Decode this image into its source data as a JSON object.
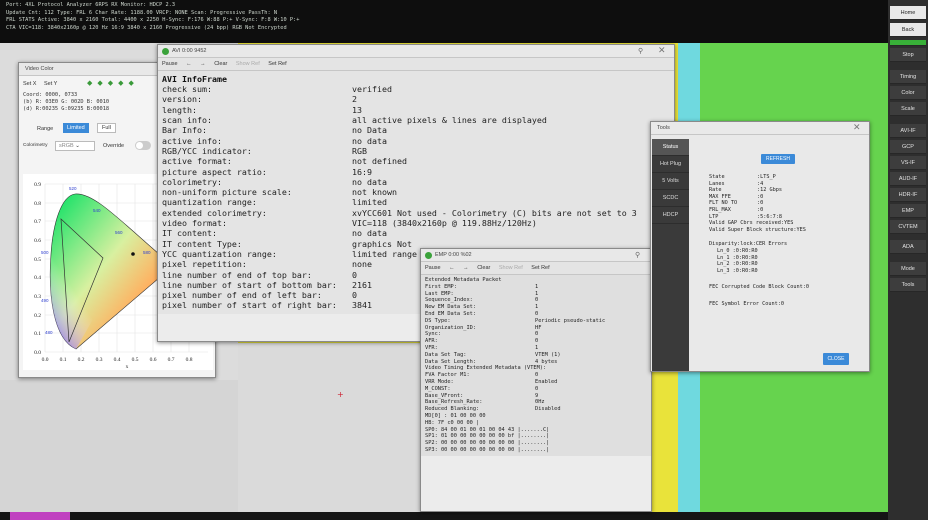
{
  "status_bar": {
    "lines": [
      "Port: 4XL Protocol Analyzer 6RPS RX   Monitor: HDCP 2.3",
      "Update Cnt: 112  Type: FRL 6  Char Rate: 1188.00  VRCP: NONE  Scan: Progressive  PassTh: N",
      "FRL STATS  Active: 3840 x 2160  Total: 4400 x 2250  H-Sync: F:176 W:88 P:+  V-Sync: F:8 W:10 P:+",
      "CTA VIC=118: 3840x2160p @ 120 Hz 16:9  3840 x 2160  Progressive  (24 bpp)  RGB  Not Encrypted"
    ]
  },
  "rail": {
    "buttons": [
      "Home",
      "Back",
      "Stop",
      "Timing",
      "Color",
      "Scale",
      "AVI-IF",
      "GCP",
      "VS-IF",
      "AUD-IF",
      "HDR-IF",
      "EMP",
      "CVTEM",
      "ADA",
      "Mode",
      "Tools"
    ]
  },
  "avi_window": {
    "title": "AVI 0:00 9452",
    "toolbar": {
      "pause": "Pause",
      "prev": "←",
      "next": "→",
      "clear": "Clear",
      "show_ref": "Show Ref",
      "set_ref": "Set Ref"
    },
    "header": "AVI InfoFrame",
    "fields": [
      {
        "k": "check sum:",
        "v": "verified"
      },
      {
        "k": "version:",
        "v": "2"
      },
      {
        "k": "length:",
        "v": "13"
      },
      {
        "k": "scan info:",
        "v": "all active pixels & lines are displayed"
      },
      {
        "k": "Bar Info:",
        "v": "no Data"
      },
      {
        "k": "active info:",
        "v": "no data"
      },
      {
        "k": "RGB/YCC indicator:",
        "v": "RGB"
      },
      {
        "k": "active format:",
        "v": "not defined"
      },
      {
        "k": "picture aspect ratio:",
        "v": "16:9"
      },
      {
        "k": "colorimetry:",
        "v": "no data"
      },
      {
        "k": "non-uniform picture scale:",
        "v": "not known"
      },
      {
        "k": "quantization range:",
        "v": "limited"
      },
      {
        "k": "extended colorimetry:",
        "v": "xvYCC601 Not used - Colorimetry (C) bits are not set to 3"
      },
      {
        "k": "video format:",
        "v": "VIC=118 (3840x2160p @ 119.88Hz/120Hz)"
      },
      {
        "k": "IT content:",
        "v": "no data"
      },
      {
        "k": "IT content Type:",
        "v": "graphics Not"
      },
      {
        "k": "YCC quantization range:",
        "v": "limited range"
      },
      {
        "k": "pixel repetition:",
        "v": "none"
      },
      {
        "k": "line number of end of top bar:",
        "v": "0"
      },
      {
        "k": "line number of start of bottom bar:",
        "v": "2161"
      },
      {
        "k": "pixel number of end of left bar:",
        "v": "0"
      },
      {
        "k": "pixel number of start of right bar:",
        "v": "3841"
      }
    ]
  },
  "emp_window": {
    "title": "EMP 0:00 %02",
    "toolbar": {
      "pause": "Pause",
      "prev": "←",
      "next": "→",
      "clear": "Clear",
      "show_ref": "Show Ref",
      "set_ref": "Set Ref"
    },
    "header": "Extended Metadata Packet",
    "fields": [
      {
        "k": "First EMP:",
        "v": "1"
      },
      {
        "k": "Last EMP:",
        "v": "1"
      },
      {
        "k": "Sequence_Index:",
        "v": "0"
      },
      {
        "k": "New EM Data Set:",
        "v": "1"
      },
      {
        "k": "End EM Data Set:",
        "v": "0"
      },
      {
        "k": "DS Type:",
        "v": "Periodic pseudo-static"
      },
      {
        "k": "Organization_ID:",
        "v": "HF"
      },
      {
        "k": "Sync:",
        "v": "0"
      },
      {
        "k": "AFR:",
        "v": "0"
      },
      {
        "k": "VFR:",
        "v": "1"
      },
      {
        "k": "Data Set Tag:",
        "v": "VTEM (1)"
      },
      {
        "k": "Data Set Length:",
        "v": "4 bytes"
      },
      {
        "k": "Video Timing Extended Metadata (VTEM):",
        "v": ""
      },
      {
        "k": "  FVA Factor M1:",
        "v": "0"
      },
      {
        "k": "  VRR Mode:",
        "v": "Enabled"
      },
      {
        "k": "  M_CONST:",
        "v": "0"
      },
      {
        "k": "  Base_VFront:",
        "v": "9"
      },
      {
        "k": "  Base_Refresh_Rate:",
        "v": "0Hz"
      },
      {
        "k": "  Reduced Blanking:",
        "v": "Disabled"
      }
    ],
    "hex": [
      "MD[0] : 01 00 00 00",
      "HB:   7F c0 00 00 |",
      "SP0: 84 00 01 00 01 00 04 43 |.......C|",
      "SP1: 01 00 00 00 00 00 00 bf |........|",
      "SP2: 00 00 00 00 00 00 00 00 |........|",
      "SP3: 00 00 00 00 00 00 00 00 |........|"
    ]
  },
  "video_color": {
    "title": "Video Color",
    "set_x": "Set X",
    "set_y": "Set Y",
    "coord": "Coord: 0000, 0733",
    "b": "(b) R: 03E0 G: 002D B: 0010",
    "d": "(d) R:00235 G:09235 B:00018",
    "range_label": "Range",
    "limited": "Limited",
    "full": "Full",
    "colorimetry_label": "Colorimetry",
    "colorimetry_value": "sRGB",
    "override_label": "Override",
    "x_ticks": [
      "0.0",
      "0.1",
      "0.2",
      "0.3",
      "0.4",
      "0.5",
      "0.6",
      "0.7",
      "0.8"
    ],
    "y_ticks": [
      "0.9",
      "0.8",
      "0.7",
      "0.6",
      "0.5",
      "0.4",
      "0.3",
      "0.2",
      "0.1",
      "0.0"
    ],
    "x_label": "x",
    "wl_labels": [
      "520",
      "540",
      "560",
      "580",
      "600",
      "500",
      "490",
      "480"
    ]
  },
  "tools_window": {
    "title": "Tools",
    "tabs": [
      "Status",
      "Hot Plug",
      "5 Volts",
      "SCDC",
      "HDCP"
    ],
    "refresh": "REFRESH",
    "close": "CLOSE",
    "status": [
      {
        "k": "State",
        "v": ":LTS_P"
      },
      {
        "k": "Lanes",
        "v": ":4"
      },
      {
        "k": "Rate",
        "v": ":12 Gbps"
      },
      {
        "k": "MAX FFE",
        "v": ":0"
      },
      {
        "k": "FLT NO TO",
        "v": ":0"
      },
      {
        "k": "FRL_MAX",
        "v": ":0"
      },
      {
        "k": "LTP",
        "v": ":5:6:7:8"
      }
    ],
    "valid1": "Valid GAP Cbrs received:YES",
    "valid2": "Valid Super Block structure:YES",
    "disparity_header": "Disparity:lock:CER Errors",
    "lanes": [
      "Ln_0 :0:R0:R0",
      "Ln_1 :0:R0:R0",
      "Ln_2 :0:R0:R0",
      "Ln_3 :0:R0:R0"
    ],
    "fec1": "FEC Corrupted Code Block Count:0",
    "fec2": "FEC Symbol Error Count:0"
  },
  "pattern_colors": [
    "#e4e4e4",
    "#f7f7f7",
    "#e8e400",
    "#62d6e0",
    "#65d24c",
    "#c6c6c6",
    "#5ad85a"
  ]
}
